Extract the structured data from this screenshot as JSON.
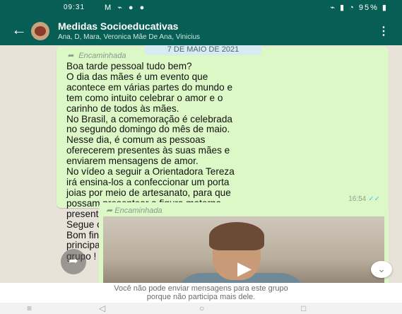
{
  "status_bar": {
    "time": "09:31",
    "left_icons": "M ⌁ ● ●",
    "right_icons": "⌁ ▮ ◔ 95% ▮"
  },
  "header": {
    "back_icon": "←",
    "title": "Medidas Socioeducativas",
    "subtitle": "Ana, D, Mara, Veronica Mãe De Ana, Vinicius",
    "menu_icon": "⋮"
  },
  "date_chip": "7 DE MAIO DE 2021",
  "message1": {
    "forwarded_label": "Encaminhada",
    "text": "Boa tarde pessoal tudo bem?\nO dia das mães é um evento que\nacontece em várias partes do mundo e\ntem como intuito celebrar o amor e o\ncarinho de todos às mães.\nNo Brasil, a comemoração é celebrada\nno segundo domingo do mês de maio.\nNesse dia, é comum as pessoas\noferecerem presentes às suas mães e\nenviarem mensagens de amor.\nNo vídeo a seguir a Orientadora Tereza\nirá ensina-los a confeccionar um porta\njoias por meio de artesanato, para que\npossam presentear a figura materna\npresente em sua vida.\nSegue o texto de apoio em anexo\nBom final de semana a todos e\nprincipalmente para as mamães aqui no\ngrupo !",
    "time": "16:54"
  },
  "message2": {
    "forwarded_label": "Encaminhada",
    "play_icon": "▶"
  },
  "notice": {
    "line1": "Você não pode enviar mensagens para este grupo",
    "line2": "porque não participa mais dele."
  },
  "navbar": {
    "menu_icon": "≡",
    "back_icon": "◁",
    "home_icon": "○",
    "recents_icon": "□"
  },
  "colors": {
    "header_bg": "#075e54",
    "bubble_bg": "#dcf8c6",
    "chat_bg": "#e8e2d8",
    "read_ticks": "#4fc3f7"
  }
}
